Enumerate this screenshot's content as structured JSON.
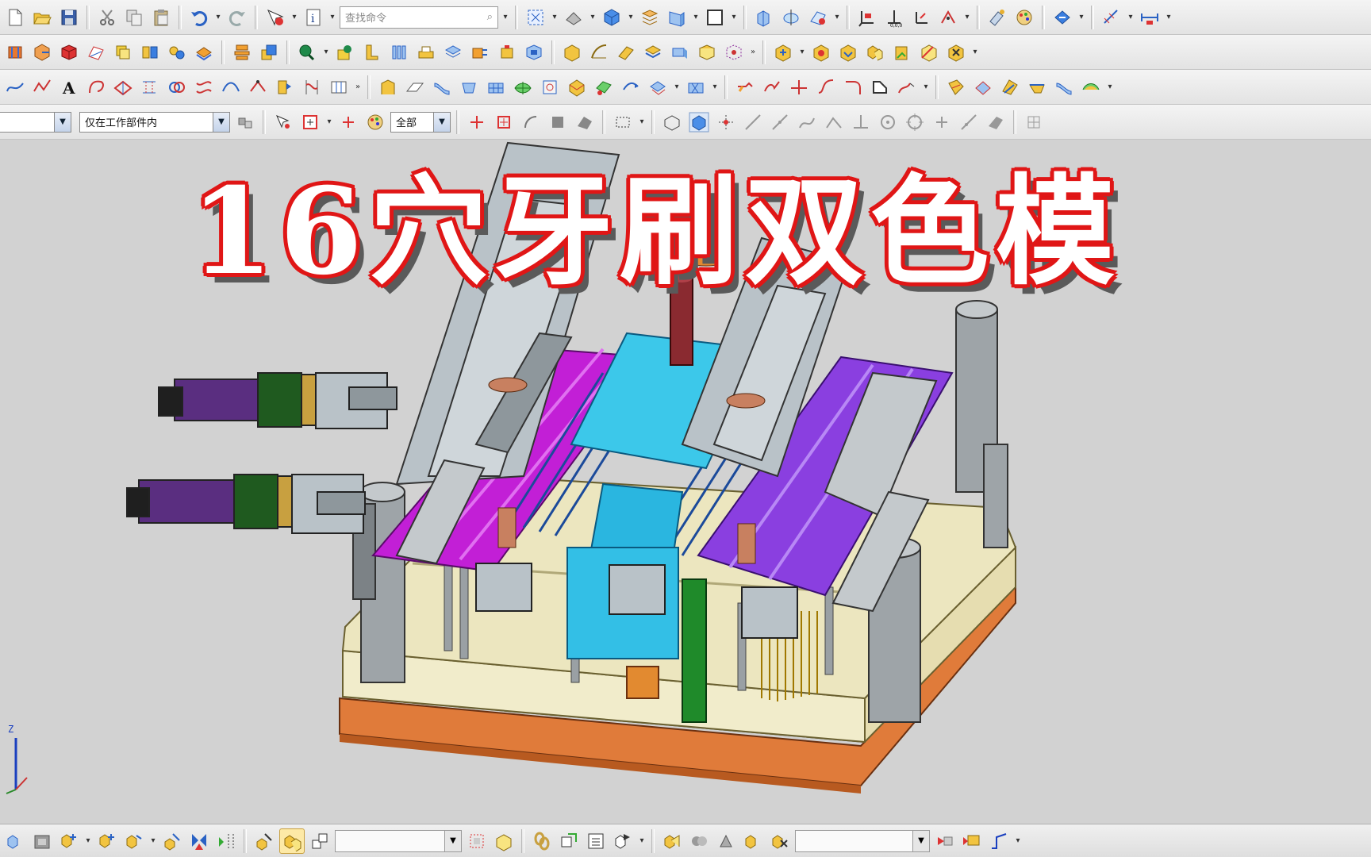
{
  "toolbar": {
    "search_placeholder": "查找命令"
  },
  "filter_bar": {
    "scope_value": "仅在工作部件内",
    "type_value": "全部"
  },
  "overlay": {
    "title": "16穴牙刷双色模"
  },
  "axis_triad": {
    "z_label": "Z"
  },
  "colors": {
    "title_text": "#ffffff",
    "title_outline": "#e01616",
    "mold_plate_beige": "#ece6bf",
    "mold_base_orange": "#e07b3a",
    "cavity_magenta": "#c21fd6",
    "cavity_purple": "#8a3fe0",
    "core_cyan": "#3cc8ea",
    "slider_gray": "#b9c2c8",
    "cylinder_green": "#1f5a1f"
  }
}
